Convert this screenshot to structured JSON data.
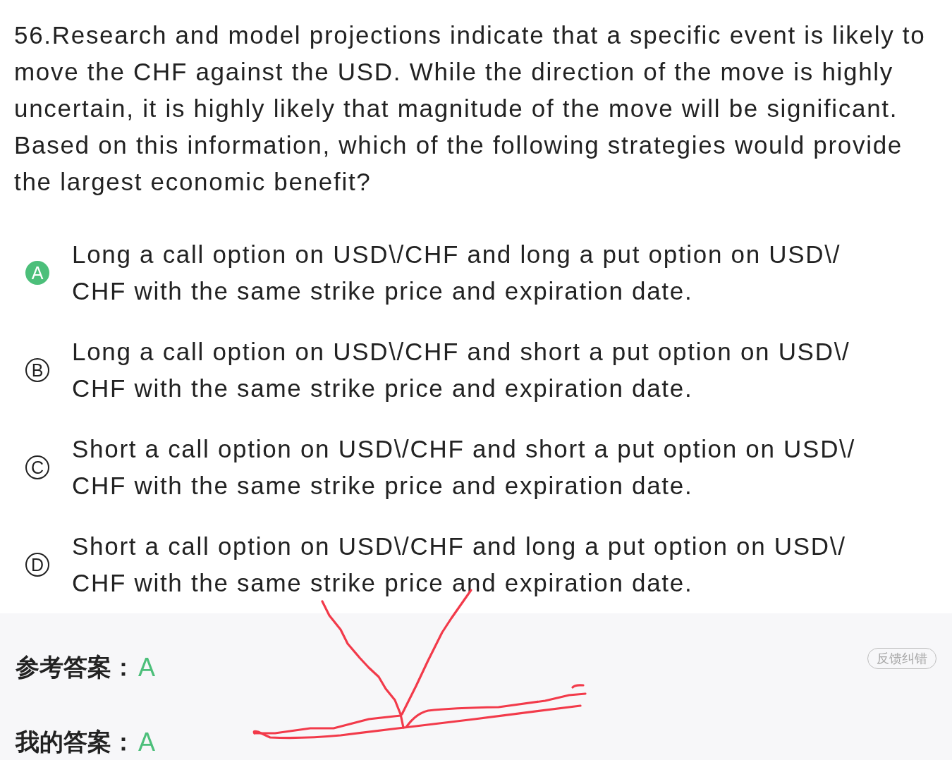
{
  "question": {
    "text": "56.Research and model projections indicate that a specific event is likely to move the CHF against the USD. While the direction of the move is highly uncertain, it is highly likely that magnitude of the move will be significant. Based on this information, which of the following strategies would provide the largest economic benefit?"
  },
  "options": [
    {
      "letter": "A",
      "text": "Long a call option on USD\\/CHF and long a put option on USD\\/CHF with the same strike price and expiration date.",
      "selected": true
    },
    {
      "letter": "B",
      "text": "Long a call option on USD\\/CHF and short a put option on USD\\/CHF with the same strike price and expiration date.",
      "selected": false
    },
    {
      "letter": "C",
      "text": "Short a call option on USD\\/CHF and short a put option on USD\\/CHF with the same strike price and expiration date.",
      "selected": false
    },
    {
      "letter": "D",
      "text": "Short a call option on USD\\/CHF and long a put option on USD\\/CHF with the same strike price and expiration date.",
      "selected": false
    }
  ],
  "answers": [
    {
      "label": "参考答案：",
      "value": "A"
    },
    {
      "label": "我的答案：",
      "value": "A"
    }
  ],
  "feedback_button": {
    "label": "反馈纠错"
  }
}
